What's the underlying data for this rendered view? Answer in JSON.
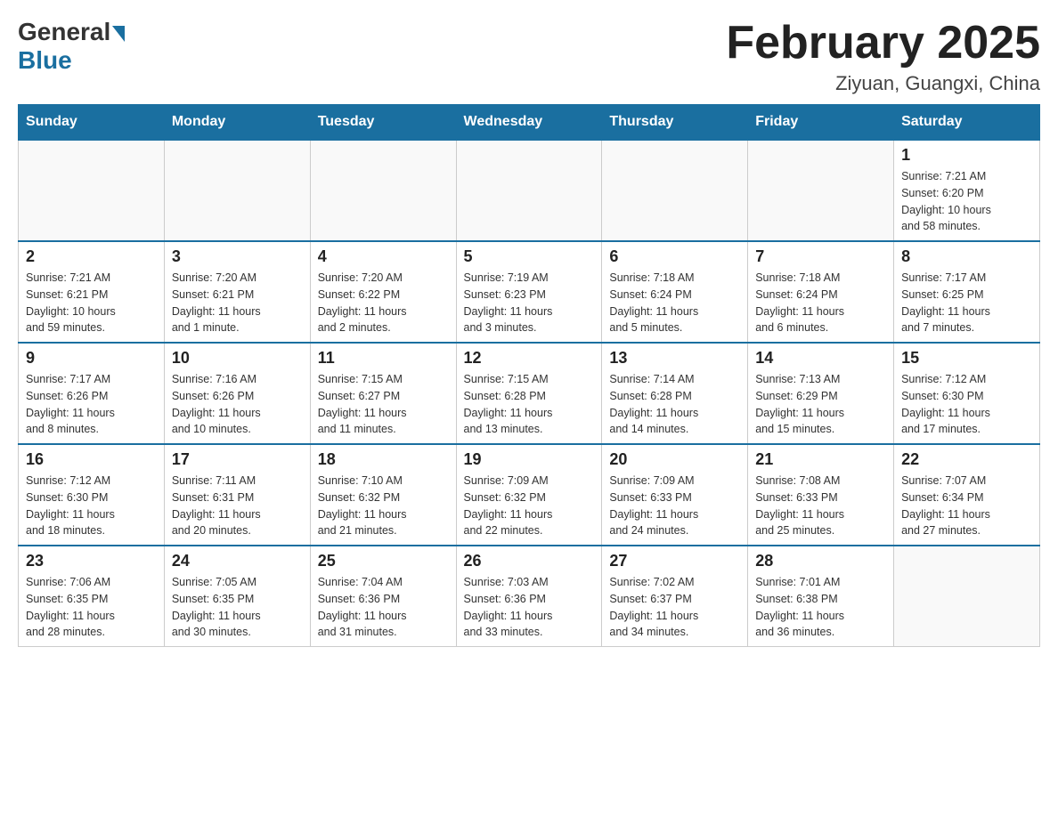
{
  "header": {
    "logo_general": "General",
    "logo_blue": "Blue",
    "title": "February 2025",
    "subtitle": "Ziyuan, Guangxi, China"
  },
  "days_of_week": [
    "Sunday",
    "Monday",
    "Tuesday",
    "Wednesday",
    "Thursday",
    "Friday",
    "Saturday"
  ],
  "weeks": [
    [
      {
        "day": "",
        "info": ""
      },
      {
        "day": "",
        "info": ""
      },
      {
        "day": "",
        "info": ""
      },
      {
        "day": "",
        "info": ""
      },
      {
        "day": "",
        "info": ""
      },
      {
        "day": "",
        "info": ""
      },
      {
        "day": "1",
        "info": "Sunrise: 7:21 AM\nSunset: 6:20 PM\nDaylight: 10 hours\nand 58 minutes."
      }
    ],
    [
      {
        "day": "2",
        "info": "Sunrise: 7:21 AM\nSunset: 6:21 PM\nDaylight: 10 hours\nand 59 minutes."
      },
      {
        "day": "3",
        "info": "Sunrise: 7:20 AM\nSunset: 6:21 PM\nDaylight: 11 hours\nand 1 minute."
      },
      {
        "day": "4",
        "info": "Sunrise: 7:20 AM\nSunset: 6:22 PM\nDaylight: 11 hours\nand 2 minutes."
      },
      {
        "day": "5",
        "info": "Sunrise: 7:19 AM\nSunset: 6:23 PM\nDaylight: 11 hours\nand 3 minutes."
      },
      {
        "day": "6",
        "info": "Sunrise: 7:18 AM\nSunset: 6:24 PM\nDaylight: 11 hours\nand 5 minutes."
      },
      {
        "day": "7",
        "info": "Sunrise: 7:18 AM\nSunset: 6:24 PM\nDaylight: 11 hours\nand 6 minutes."
      },
      {
        "day": "8",
        "info": "Sunrise: 7:17 AM\nSunset: 6:25 PM\nDaylight: 11 hours\nand 7 minutes."
      }
    ],
    [
      {
        "day": "9",
        "info": "Sunrise: 7:17 AM\nSunset: 6:26 PM\nDaylight: 11 hours\nand 8 minutes."
      },
      {
        "day": "10",
        "info": "Sunrise: 7:16 AM\nSunset: 6:26 PM\nDaylight: 11 hours\nand 10 minutes."
      },
      {
        "day": "11",
        "info": "Sunrise: 7:15 AM\nSunset: 6:27 PM\nDaylight: 11 hours\nand 11 minutes."
      },
      {
        "day": "12",
        "info": "Sunrise: 7:15 AM\nSunset: 6:28 PM\nDaylight: 11 hours\nand 13 minutes."
      },
      {
        "day": "13",
        "info": "Sunrise: 7:14 AM\nSunset: 6:28 PM\nDaylight: 11 hours\nand 14 minutes."
      },
      {
        "day": "14",
        "info": "Sunrise: 7:13 AM\nSunset: 6:29 PM\nDaylight: 11 hours\nand 15 minutes."
      },
      {
        "day": "15",
        "info": "Sunrise: 7:12 AM\nSunset: 6:30 PM\nDaylight: 11 hours\nand 17 minutes."
      }
    ],
    [
      {
        "day": "16",
        "info": "Sunrise: 7:12 AM\nSunset: 6:30 PM\nDaylight: 11 hours\nand 18 minutes."
      },
      {
        "day": "17",
        "info": "Sunrise: 7:11 AM\nSunset: 6:31 PM\nDaylight: 11 hours\nand 20 minutes."
      },
      {
        "day": "18",
        "info": "Sunrise: 7:10 AM\nSunset: 6:32 PM\nDaylight: 11 hours\nand 21 minutes."
      },
      {
        "day": "19",
        "info": "Sunrise: 7:09 AM\nSunset: 6:32 PM\nDaylight: 11 hours\nand 22 minutes."
      },
      {
        "day": "20",
        "info": "Sunrise: 7:09 AM\nSunset: 6:33 PM\nDaylight: 11 hours\nand 24 minutes."
      },
      {
        "day": "21",
        "info": "Sunrise: 7:08 AM\nSunset: 6:33 PM\nDaylight: 11 hours\nand 25 minutes."
      },
      {
        "day": "22",
        "info": "Sunrise: 7:07 AM\nSunset: 6:34 PM\nDaylight: 11 hours\nand 27 minutes."
      }
    ],
    [
      {
        "day": "23",
        "info": "Sunrise: 7:06 AM\nSunset: 6:35 PM\nDaylight: 11 hours\nand 28 minutes."
      },
      {
        "day": "24",
        "info": "Sunrise: 7:05 AM\nSunset: 6:35 PM\nDaylight: 11 hours\nand 30 minutes."
      },
      {
        "day": "25",
        "info": "Sunrise: 7:04 AM\nSunset: 6:36 PM\nDaylight: 11 hours\nand 31 minutes."
      },
      {
        "day": "26",
        "info": "Sunrise: 7:03 AM\nSunset: 6:36 PM\nDaylight: 11 hours\nand 33 minutes."
      },
      {
        "day": "27",
        "info": "Sunrise: 7:02 AM\nSunset: 6:37 PM\nDaylight: 11 hours\nand 34 minutes."
      },
      {
        "day": "28",
        "info": "Sunrise: 7:01 AM\nSunset: 6:38 PM\nDaylight: 11 hours\nand 36 minutes."
      },
      {
        "day": "",
        "info": ""
      }
    ]
  ]
}
